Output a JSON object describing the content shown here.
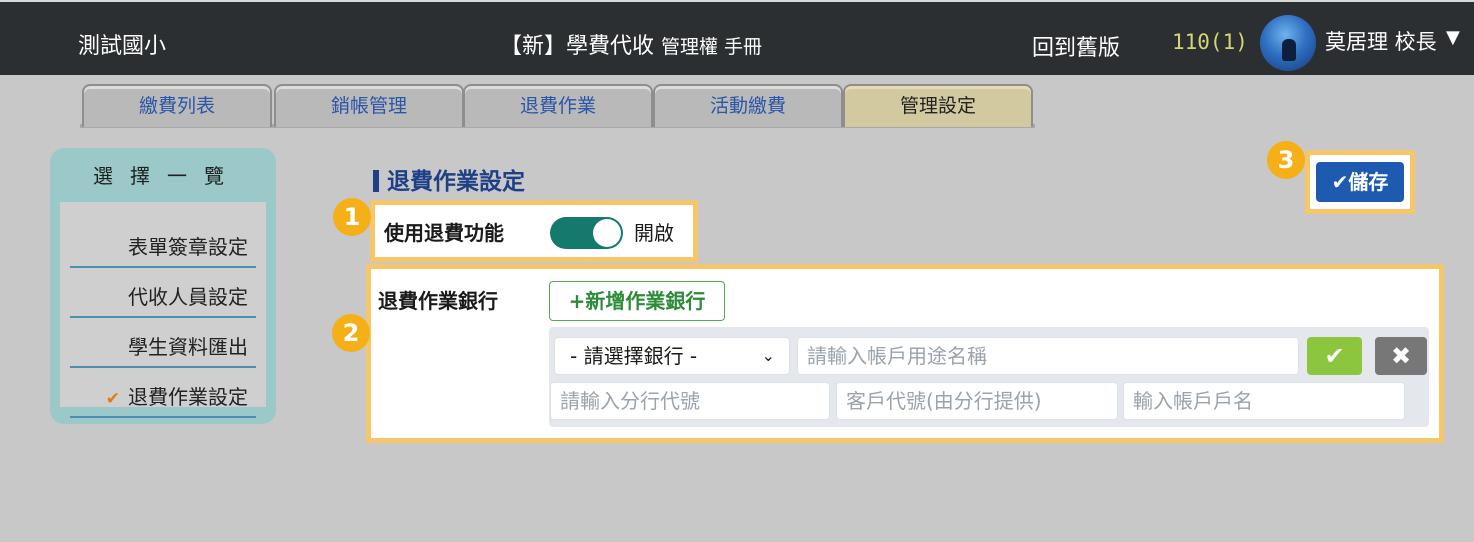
{
  "header": {
    "school": "測試國小",
    "title": "【新】學費代收",
    "subtitle": "管理權 手冊",
    "back_old": "回到舊版",
    "term": "110(1)",
    "user": "莫居理 校長",
    "user_menu_icon": "chevron-down-icon"
  },
  "tabs": [
    {
      "label": "繳費列表",
      "active": false
    },
    {
      "label": "銷帳管理",
      "active": false
    },
    {
      "label": "退費作業",
      "active": false
    },
    {
      "label": "活動繳費",
      "active": false
    },
    {
      "label": "管理設定",
      "active": true
    }
  ],
  "sidebar": {
    "title": "選擇一覽",
    "items": [
      {
        "label": "表單簽章設定",
        "active": false
      },
      {
        "label": "代收人員設定",
        "active": false
      },
      {
        "label": "學生資料匯出",
        "active": false
      },
      {
        "label": "退費作業設定",
        "active": true
      }
    ],
    "active_marker": "✔"
  },
  "main": {
    "section_title": "退費作業設定",
    "refund_toggle": {
      "label": "使用退費功能",
      "state": "開啟",
      "on": true
    },
    "bank": {
      "label": "退費作業銀行",
      "add_button": "+新增作業銀行",
      "select_value": "- 請選擇銀行 -",
      "account_purpose_placeholder": "請輸入帳戶用途名稱",
      "branch_code_placeholder": "請輸入分行代號",
      "customer_code_placeholder": "客戶代號(由分行提供)",
      "account_name_placeholder": "輸入帳戶戶名",
      "confirm_icon": "✔",
      "cancel_icon": "✖"
    },
    "save_button": "✔儲存"
  },
  "annotations": [
    "1",
    "2",
    "3"
  ],
  "colors": {
    "topbar": "#2b2f31",
    "highlight": "#f6c76a",
    "badge": "#f4b016",
    "accent_blue": "#1f3f86",
    "toggle_on": "#157a6e",
    "save": "#1e5bb0"
  }
}
